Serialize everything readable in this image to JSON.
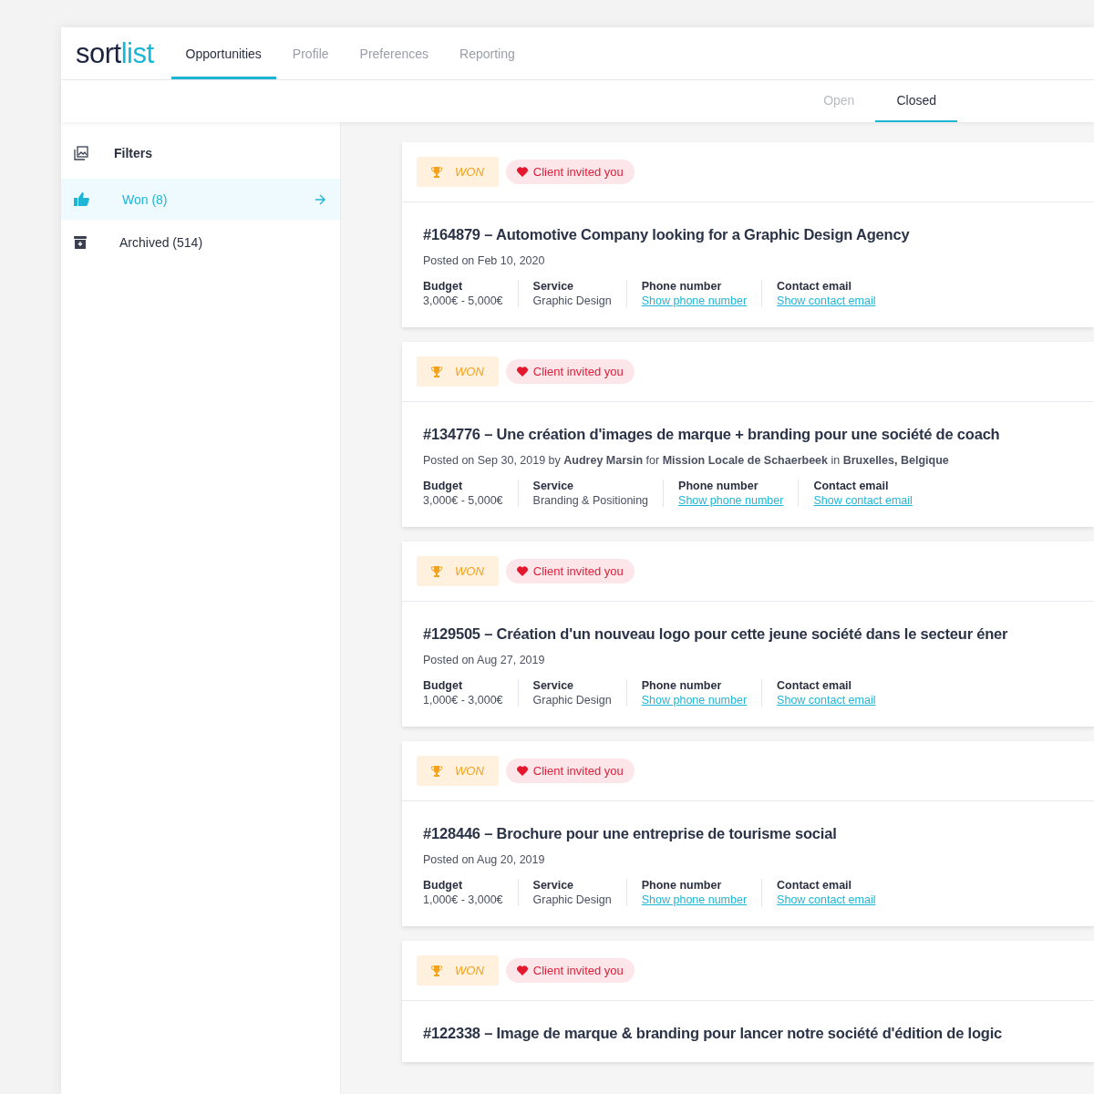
{
  "logo": {
    "dark": "sort",
    "accent": "list"
  },
  "nav_tabs": [
    {
      "label": "Opportunities",
      "selected": true
    },
    {
      "label": "Profile",
      "selected": false
    },
    {
      "label": "Preferences",
      "selected": false
    },
    {
      "label": "Reporting",
      "selected": false
    }
  ],
  "status_tabs": [
    {
      "label": "Open",
      "selected": false
    },
    {
      "label": "Closed",
      "selected": true
    }
  ],
  "sidebar": {
    "title": "Filters",
    "items": [
      {
        "kind": "won",
        "label": "Won (8)",
        "selected": true
      },
      {
        "kind": "archived",
        "label": "Archived (514)",
        "selected": false
      }
    ]
  },
  "cards": [
    {
      "status": "WON",
      "tag": "Client invited you",
      "title": "#164879 – Automotive Company looking for a Graphic Design Agency",
      "posted": "Posted on Feb 10, 2020",
      "fields": [
        {
          "kind": "text",
          "label": "Budget",
          "value": "3,000€ - 5,000€"
        },
        {
          "kind": "text",
          "label": "Service",
          "value": "Graphic Design"
        },
        {
          "kind": "link",
          "label": "Phone number",
          "value": "Show phone number"
        },
        {
          "kind": "link",
          "label": "Contact email",
          "value": "Show contact email"
        }
      ]
    },
    {
      "status": "WON",
      "tag": "Client invited you",
      "title": "#134776 – Une création d'images de marque + branding pour une société de coach",
      "posted": "Posted on Sep 30, 2019 by **Audrey Marsin** for **Mission Locale de Schaerbeek** in **Bruxelles, Belgique**",
      "fields": [
        {
          "kind": "text",
          "label": "Budget",
          "value": "3,000€ - 5,000€"
        },
        {
          "kind": "text",
          "label": "Service",
          "value": "Branding & Positioning"
        },
        {
          "kind": "link",
          "label": "Phone number",
          "value": "Show phone number"
        },
        {
          "kind": "link",
          "label": "Contact email",
          "value": "Show contact email"
        }
      ]
    },
    {
      "status": "WON",
      "tag": "Client invited you",
      "title": "#129505 – Création d'un nouveau logo pour cette jeune société dans le secteur éner",
      "posted": "Posted on Aug 27, 2019",
      "fields": [
        {
          "kind": "text",
          "label": "Budget",
          "value": "1,000€ - 3,000€"
        },
        {
          "kind": "text",
          "label": "Service",
          "value": "Graphic Design"
        },
        {
          "kind": "link",
          "label": "Phone number",
          "value": "Show phone number"
        },
        {
          "kind": "link",
          "label": "Contact email",
          "value": "Show contact email"
        }
      ]
    },
    {
      "status": "WON",
      "tag": "Client invited you",
      "title": "#128446 – Brochure pour une entreprise de tourisme social",
      "posted": "Posted on Aug 20, 2019",
      "fields": [
        {
          "kind": "text",
          "label": "Budget",
          "value": "1,000€ - 3,000€"
        },
        {
          "kind": "text",
          "label": "Service",
          "value": "Graphic Design"
        },
        {
          "kind": "link",
          "label": "Phone number",
          "value": "Show phone number"
        },
        {
          "kind": "link",
          "label": "Contact email",
          "value": "Show contact email"
        }
      ]
    },
    {
      "status": "WON",
      "tag": "Client invited you",
      "title": "#122338 – Image de marque & branding pour lancer notre société d'édition de logic"
    }
  ]
}
